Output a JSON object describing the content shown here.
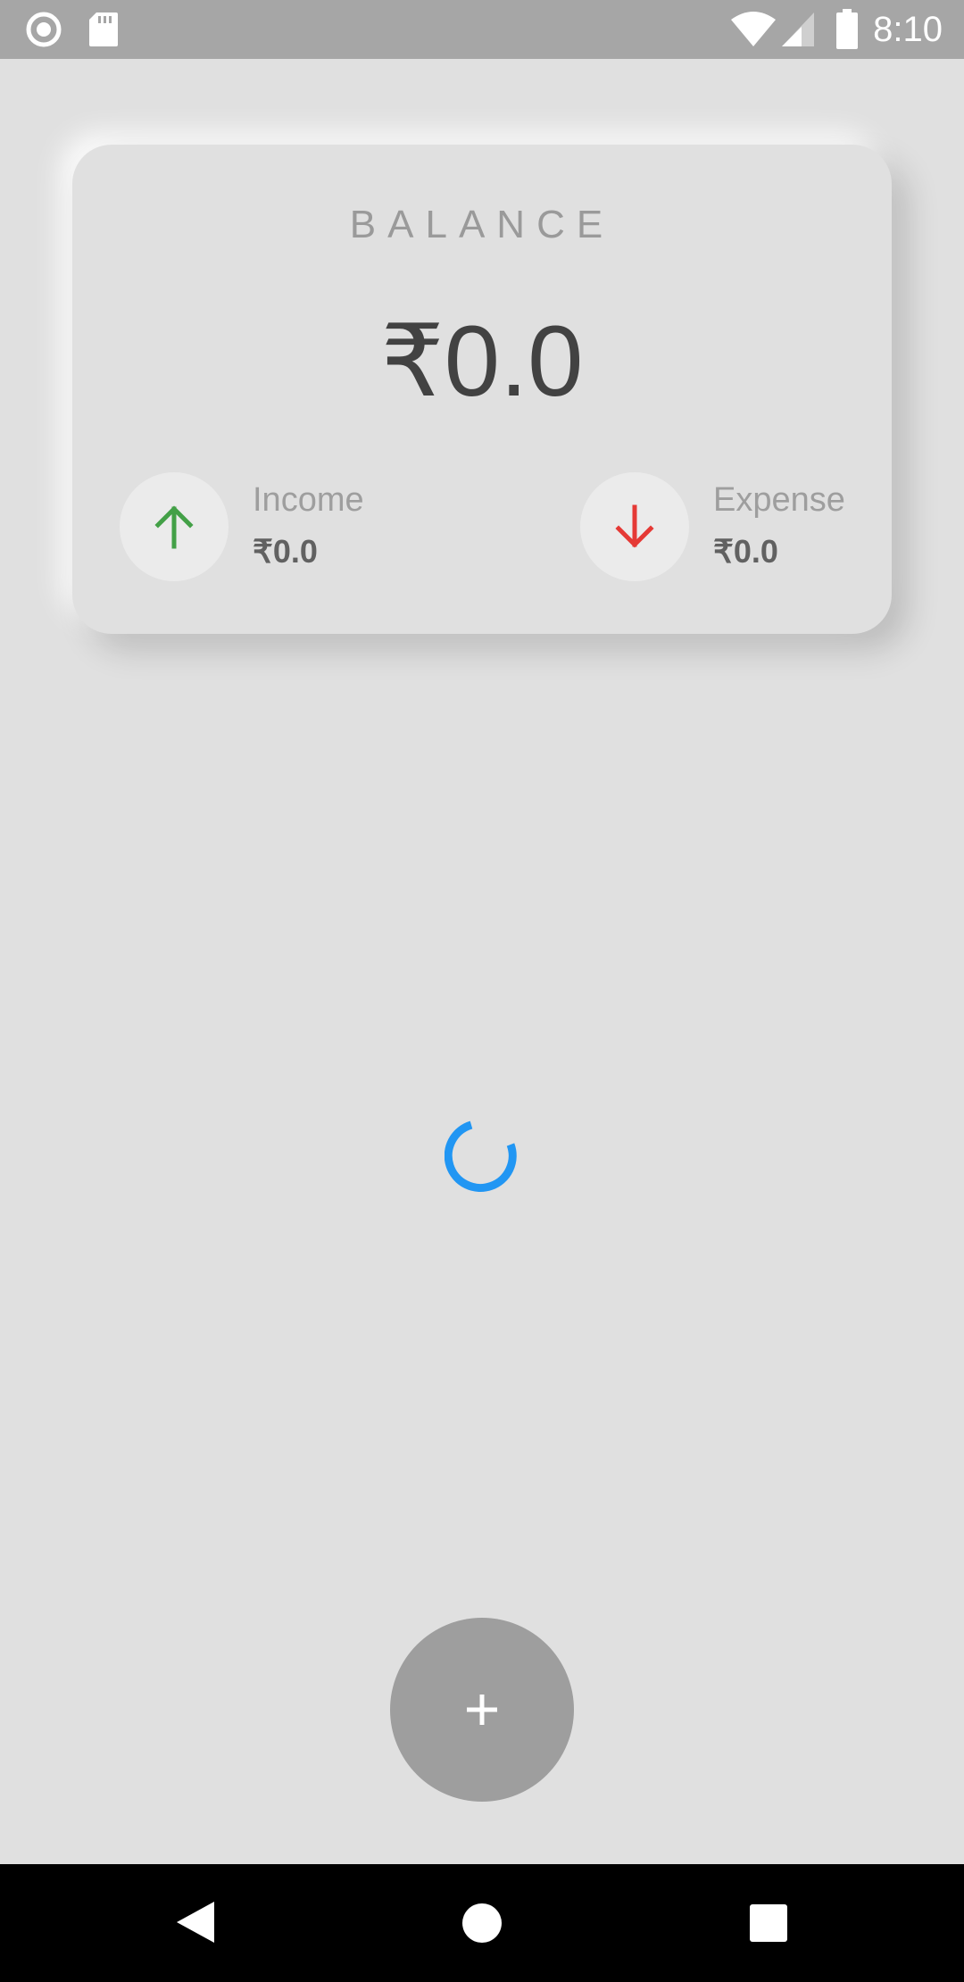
{
  "status_bar": {
    "time": "8:10",
    "icons": [
      "record-icon",
      "sd-card-icon",
      "wifi-icon",
      "signal-icon",
      "battery-icon"
    ]
  },
  "balance_card": {
    "title": "BALANCE",
    "amount": "₹0.0",
    "income": {
      "label": "Income",
      "value": "₹0.0",
      "icon": "arrow-up-icon",
      "color": "#43a047"
    },
    "expense": {
      "label": "Expense",
      "value": "₹0.0",
      "icon": "arrow-down-icon",
      "color": "#e53935"
    }
  },
  "loading": {
    "icon": "loading-spinner",
    "color": "#2196f3"
  },
  "fab": {
    "icon": "plus-icon",
    "color": "#9e9e9e"
  },
  "nav_bar": {
    "icons": [
      "back-icon",
      "home-icon",
      "recents-icon"
    ]
  }
}
